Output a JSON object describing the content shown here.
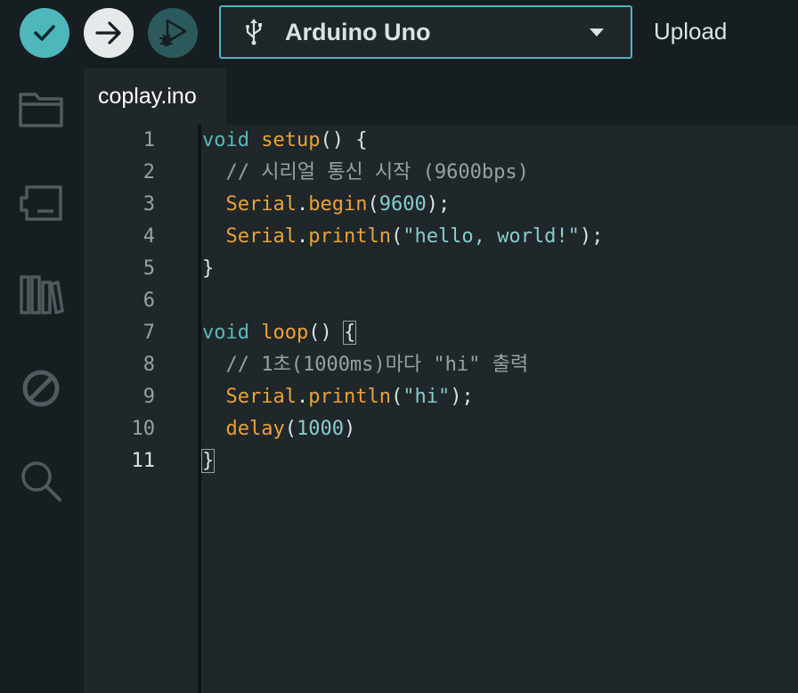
{
  "toolbar": {
    "board_name": "Arduino Uno",
    "upload_label": "Upload"
  },
  "tab": {
    "filename": "coplay.ino"
  },
  "editor": {
    "line_numbers": [
      "1",
      "2",
      "3",
      "4",
      "5",
      "6",
      "7",
      "8",
      "9",
      "10",
      "11"
    ],
    "active_line": "11",
    "lines": [
      [
        {
          "t": "void",
          "c": "kw"
        },
        {
          "t": " ",
          "c": "pl"
        },
        {
          "t": "setup",
          "c": "fn"
        },
        {
          "t": "() {",
          "c": "pl"
        }
      ],
      [
        {
          "t": "  // 시리얼 통신 시작 (9600bps)",
          "c": "cm"
        }
      ],
      [
        {
          "t": "  ",
          "c": "pl"
        },
        {
          "t": "Serial",
          "c": "fn"
        },
        {
          "t": ".",
          "c": "pl"
        },
        {
          "t": "begin",
          "c": "fn"
        },
        {
          "t": "(",
          "c": "pl"
        },
        {
          "t": "9600",
          "c": "num"
        },
        {
          "t": ");",
          "c": "pl"
        }
      ],
      [
        {
          "t": "  ",
          "c": "pl"
        },
        {
          "t": "Serial",
          "c": "fn"
        },
        {
          "t": ".",
          "c": "pl"
        },
        {
          "t": "println",
          "c": "fn"
        },
        {
          "t": "(",
          "c": "pl"
        },
        {
          "t": "\"hello, world!\"",
          "c": "str"
        },
        {
          "t": ");",
          "c": "pl"
        }
      ],
      [
        {
          "t": "}",
          "c": "pl"
        }
      ],
      [],
      [
        {
          "t": "void",
          "c": "kw"
        },
        {
          "t": " ",
          "c": "pl"
        },
        {
          "t": "loop",
          "c": "fn"
        },
        {
          "t": "() ",
          "c": "pl"
        },
        {
          "t": "{",
          "c": "pl",
          "hl": true
        }
      ],
      [
        {
          "t": "  // 1초(1000ms)마다 \"hi\" 출력",
          "c": "cm"
        }
      ],
      [
        {
          "t": "  ",
          "c": "pl"
        },
        {
          "t": "Serial",
          "c": "fn"
        },
        {
          "t": ".",
          "c": "pl"
        },
        {
          "t": "println",
          "c": "fn"
        },
        {
          "t": "(",
          "c": "pl"
        },
        {
          "t": "\"hi\"",
          "c": "str"
        },
        {
          "t": ");",
          "c": "pl"
        }
      ],
      [
        {
          "t": "  ",
          "c": "pl"
        },
        {
          "t": "delay",
          "c": "fn"
        },
        {
          "t": "(",
          "c": "pl"
        },
        {
          "t": "1000",
          "c": "num"
        },
        {
          "t": ")",
          "c": "pl"
        }
      ],
      [
        {
          "t": "}",
          "c": "pl",
          "hl": true
        }
      ]
    ]
  },
  "colors": {
    "accent": "#4db7bb",
    "keyword": "#5bb7ba",
    "function": "#e9a23b",
    "literal": "#89cbcd",
    "comment": "#95a2a4"
  },
  "icons": {
    "verify": "checkmark-icon",
    "upload": "arrow-right-icon",
    "debug": "debug-icon",
    "board": "usb-icon",
    "sidebar": [
      "folder-icon",
      "board-manager-icon",
      "library-icon",
      "debug-disabled-icon",
      "search-icon"
    ]
  }
}
